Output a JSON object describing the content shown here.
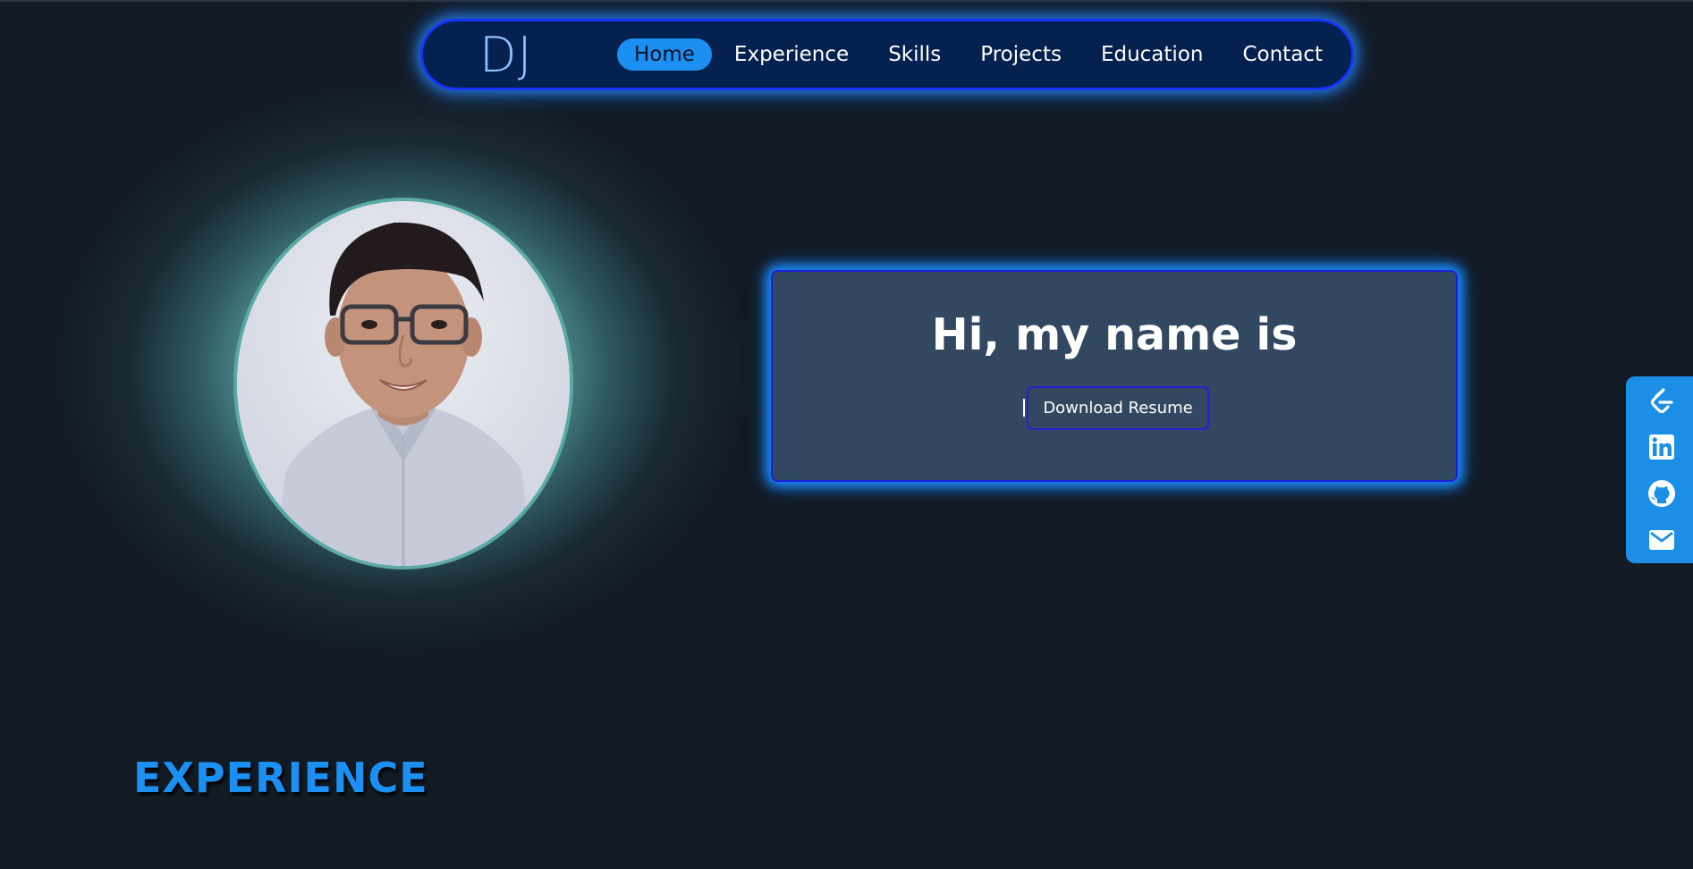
{
  "nav": {
    "logo": "DJ",
    "items": [
      {
        "label": "Home",
        "active": true
      },
      {
        "label": "Experience",
        "active": false
      },
      {
        "label": "Skills",
        "active": false
      },
      {
        "label": "Projects",
        "active": false
      },
      {
        "label": "Education",
        "active": false
      },
      {
        "label": "Contact",
        "active": false
      }
    ]
  },
  "hero": {
    "greeting": "Hi, my name is",
    "resume_button": "Download Resume"
  },
  "social": {
    "items": [
      {
        "icon": "leetcode-icon"
      },
      {
        "icon": "linkedin-icon"
      },
      {
        "icon": "github-icon"
      },
      {
        "icon": "mail-icon"
      }
    ]
  },
  "sections": {
    "experience_title": "EXPERIENCE"
  },
  "colors": {
    "background": "#121a23",
    "accent": "#1b8ff2",
    "nav_background": "#04214f",
    "card_background": "#324860",
    "glow": "#73c8c8"
  }
}
